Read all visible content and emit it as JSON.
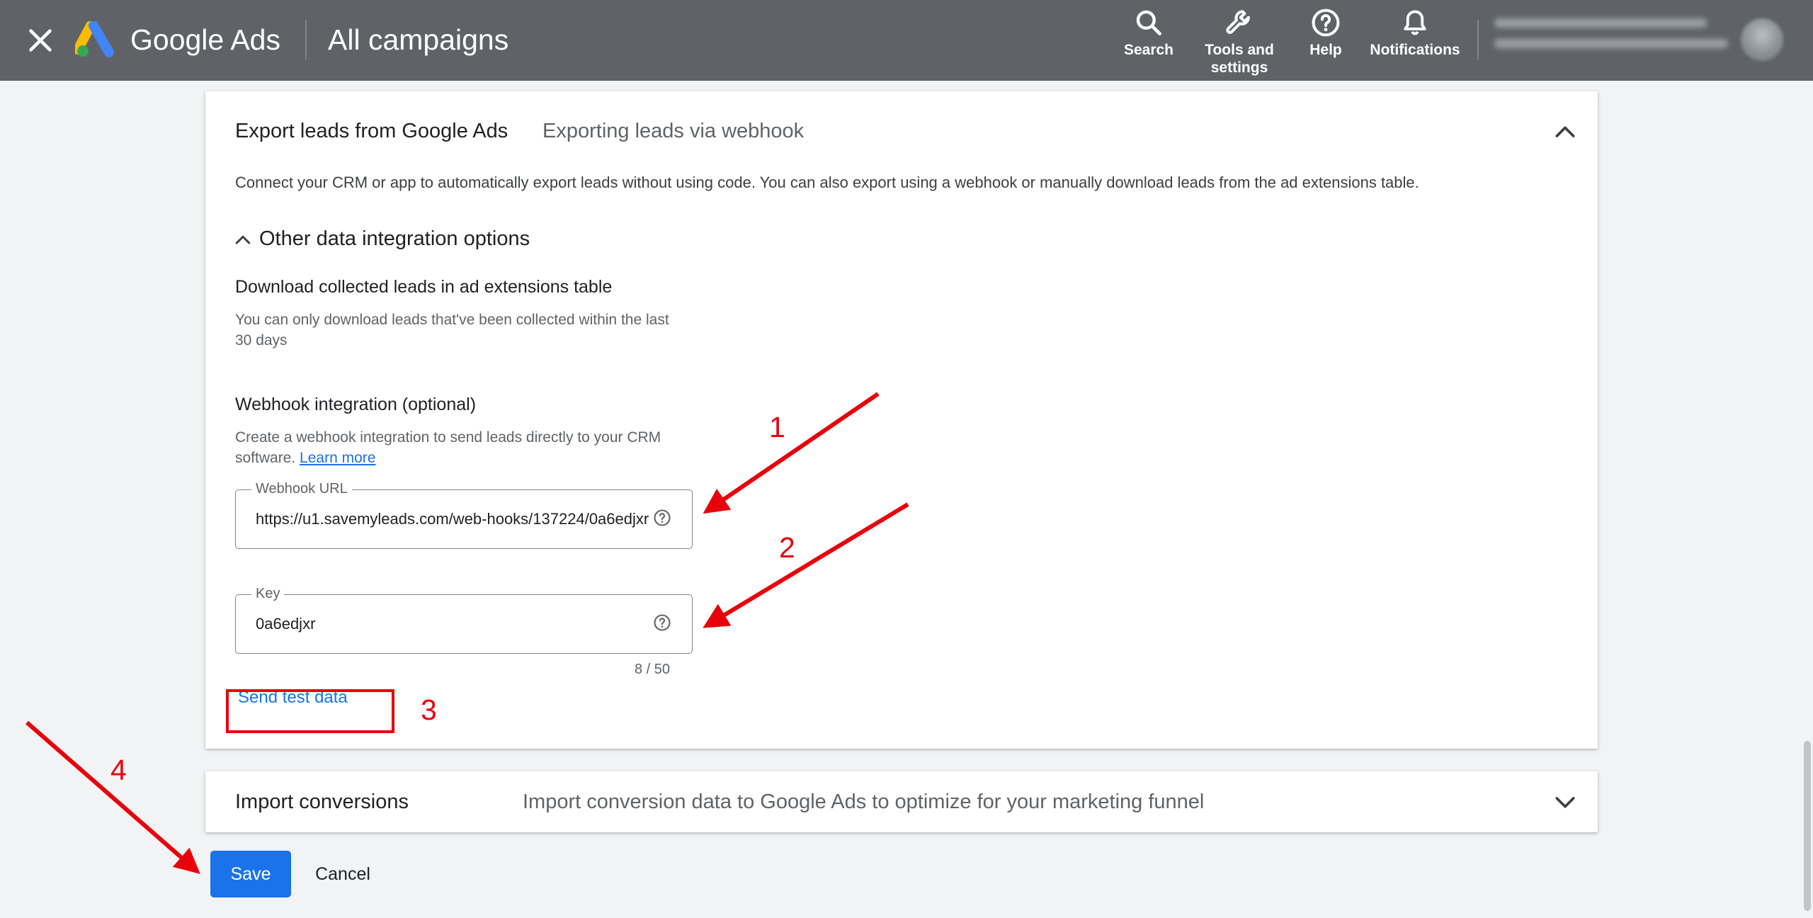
{
  "header": {
    "brand": "Google Ads",
    "page_title": "All campaigns",
    "actions": [
      {
        "label": "Search",
        "icon": "search-icon"
      },
      {
        "label": "Tools and settings",
        "icon": "wrench-icon"
      },
      {
        "label": "Help",
        "icon": "help-icon"
      },
      {
        "label": "Notifications",
        "icon": "bell-icon"
      }
    ],
    "background_color": "#5f6368"
  },
  "export_section": {
    "title": "Export leads from Google Ads",
    "subtitle": "Exporting leads via webhook",
    "description": "Connect your CRM or app to automatically export leads without using code. You can also export using a webhook or manually download leads from the ad extensions table.",
    "other_options_label": "Other data integration options",
    "download": {
      "heading": "Download collected leads in ad extensions table",
      "text": "You can only download leads that've been collected within the last 30 days"
    },
    "webhook": {
      "heading": "Webhook integration (optional)",
      "text": "Create a webhook integration to send leads directly to your CRM software.",
      "learn_more": "Learn more",
      "url_label": "Webhook URL",
      "url_value": "https://u1.savemyleads.com/web-hooks/137224/0a6edjxr",
      "key_label": "Key",
      "key_value": "0a6edjxr",
      "key_counter": "8 / 50",
      "send_test": "Send test data"
    }
  },
  "import_section": {
    "title": "Import conversions",
    "subtitle": "Import conversion data to Google Ads to optimize for your marketing funnel"
  },
  "footer": {
    "save": "Save",
    "cancel": "Cancel"
  },
  "annotations": {
    "numbers": [
      "1",
      "2",
      "3",
      "4"
    ],
    "color": "#e8000b"
  },
  "colors": {
    "primary": "#1a73e8",
    "page_background": "#f1f3f4"
  }
}
